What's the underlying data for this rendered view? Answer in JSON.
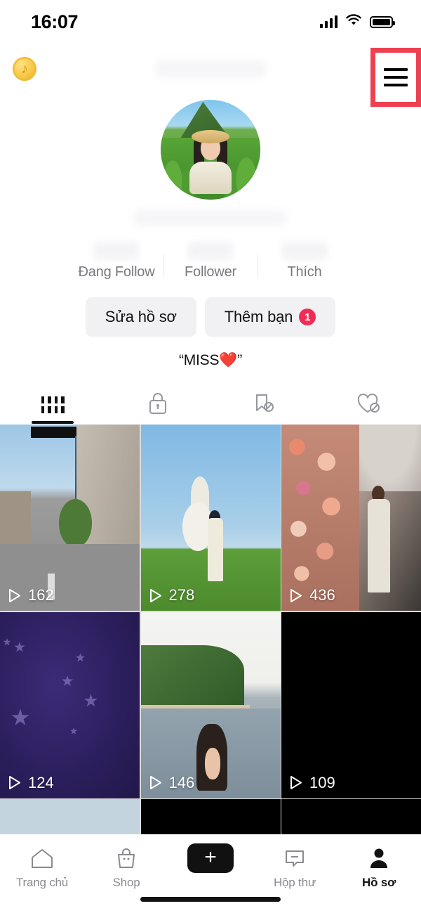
{
  "status_bar": {
    "time": "16:07",
    "signal_icon": "signal-bars-icon",
    "wifi_icon": "wifi-icon",
    "battery_icon": "battery-icon"
  },
  "top_bar": {
    "coin_icon": "tiktok-coin-icon",
    "coin_glyph": "♪",
    "username_redacted": "",
    "friend_avatar_icon": "friend-avatar-icon",
    "friend_request_count": "1",
    "menu_icon": "hamburger-menu-icon",
    "highlight_color": "#EE4050"
  },
  "profile": {
    "avatar_alt": "profile-photo-woman-straw-hat-green-field",
    "handle_redacted": "",
    "stats": [
      {
        "label": "Đang Follow",
        "value_redacted": ""
      },
      {
        "label": "Follower",
        "value_redacted": ""
      },
      {
        "label": "Thích",
        "value_redacted": ""
      }
    ],
    "buttons": [
      {
        "label": "Sửa hồ sơ",
        "badge": ""
      },
      {
        "label": "Thêm bạn",
        "badge": "1"
      }
    ],
    "bio": "“MISS❤️”"
  },
  "content_tabs": [
    {
      "name": "videos-grid",
      "icon": "grid-icon",
      "active": true
    },
    {
      "name": "private",
      "icon": "lock-icon",
      "active": false
    },
    {
      "name": "saved-hidden",
      "icon": "bookmark-off-icon",
      "active": false
    },
    {
      "name": "liked-hidden",
      "icon": "heart-off-icon",
      "active": false
    }
  ],
  "video_grid": [
    {
      "views": "162",
      "art": "art-street",
      "alt": "city-street-with-motorbikes"
    },
    {
      "views": "278",
      "art": "art-field",
      "alt": "woman-with-balloons-on-grass-field"
    },
    {
      "views": "436",
      "art": "art-flower",
      "alt": "woman-at-flower-wall-event"
    },
    {
      "views": "124",
      "art": "art-stars",
      "alt": "purple-starry-night-background"
    },
    {
      "views": "146",
      "art": "art-beach",
      "alt": "woman-swimming-at-beach"
    },
    {
      "views": "109",
      "art": "art-black",
      "alt": "dark-video-thumbnail"
    }
  ],
  "video_grid_partial_row": [
    {
      "art": "art-lightblue",
      "alt": "light-blue-thumbnail"
    },
    {
      "art": "art-black",
      "alt": "dark-thumbnail"
    },
    {
      "art": "art-black",
      "alt": "dark-thumbnail"
    }
  ],
  "bottom_nav": [
    {
      "label": "Trang chủ",
      "icon": "home-icon",
      "active": false
    },
    {
      "label": "Shop",
      "icon": "shop-bag-icon",
      "active": false
    },
    {
      "label": "",
      "icon": "create-plus-icon",
      "active": false
    },
    {
      "label": "Hộp thư",
      "icon": "inbox-icon",
      "active": false
    },
    {
      "label": "Hồ sơ",
      "icon": "profile-person-icon",
      "active": true
    }
  ]
}
